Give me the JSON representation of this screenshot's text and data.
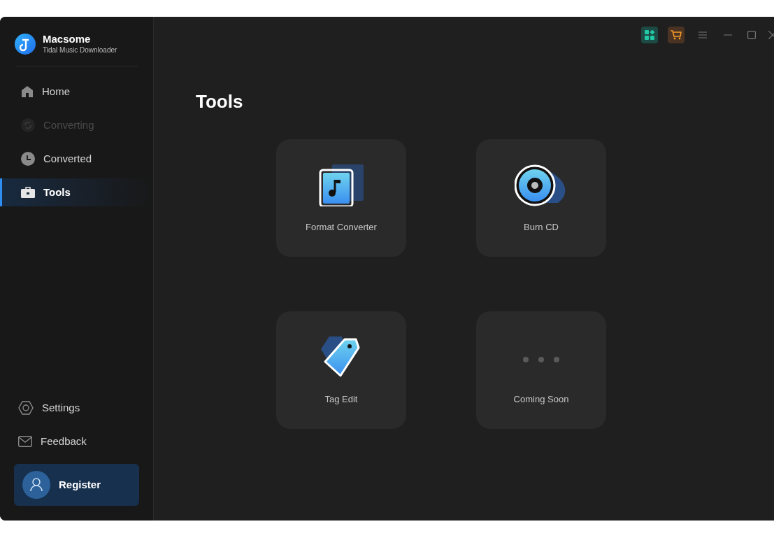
{
  "app": {
    "name": "Macsome",
    "subtitle": "Tidal Music Downloader"
  },
  "nav": [
    {
      "kind": "home",
      "label": "Home",
      "selected": false,
      "disabled": false
    },
    {
      "kind": "converting",
      "label": "Converting",
      "selected": false,
      "disabled": true
    },
    {
      "kind": "converted",
      "label": "Converted",
      "selected": false,
      "disabled": false
    },
    {
      "kind": "tools",
      "label": "Tools",
      "selected": true,
      "disabled": false
    }
  ],
  "bottom_nav": [
    {
      "kind": "settings",
      "label": "Settings"
    },
    {
      "kind": "feedback",
      "label": "Feedback"
    }
  ],
  "register": {
    "label": "Register"
  },
  "page_title": "Tools",
  "tools": [
    {
      "kind": "format",
      "label": "Format Converter"
    },
    {
      "kind": "burn",
      "label": "Burn CD"
    },
    {
      "kind": "tag",
      "label": "Tag Edit"
    },
    {
      "kind": "soon",
      "label": "Coming Soon"
    }
  ]
}
